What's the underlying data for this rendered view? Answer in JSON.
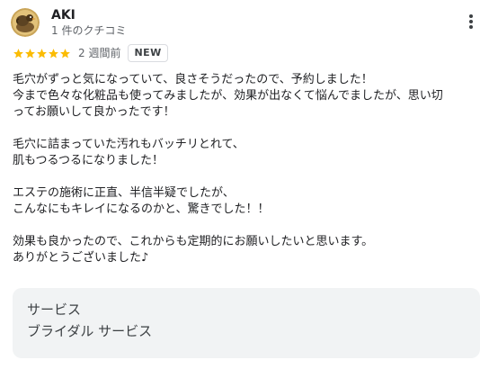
{
  "review": {
    "author": "AKI",
    "subtitle": "1 件のクチコミ",
    "rating": 5,
    "rating_max": 5,
    "date": "2 週間前",
    "badge": "NEW",
    "lines": [
      "毛穴がずっと気になっていて、良さそうだったので、予約しました！",
      "今まで色々な化粧品も使ってみましたが、効果が出なくて悩んでましたが、思い切",
      "ってお願いして良かったです！",
      "",
      "毛穴に詰まっていた汚れもバッチリとれて、",
      "肌もつるつるになりました！",
      "",
      "エステの施術に正直、半信半疑でしたが、",
      "こんなにもキレイになるのかと、驚きでした！！",
      "",
      "効果も良かったので、これからも定期的にお願いしたいと思います。",
      "ありがとうございました♪"
    ],
    "service_title": "サービス",
    "service_value": "ブライダル サービス"
  },
  "icons": {
    "avatar": "avatar-illustration",
    "more": "more-vert-icon",
    "star": "star-icon"
  },
  "colors": {
    "star": "#fbbc04",
    "text": "#202124",
    "secondary_text": "#5f6368",
    "card_background": "#f1f3f4"
  }
}
